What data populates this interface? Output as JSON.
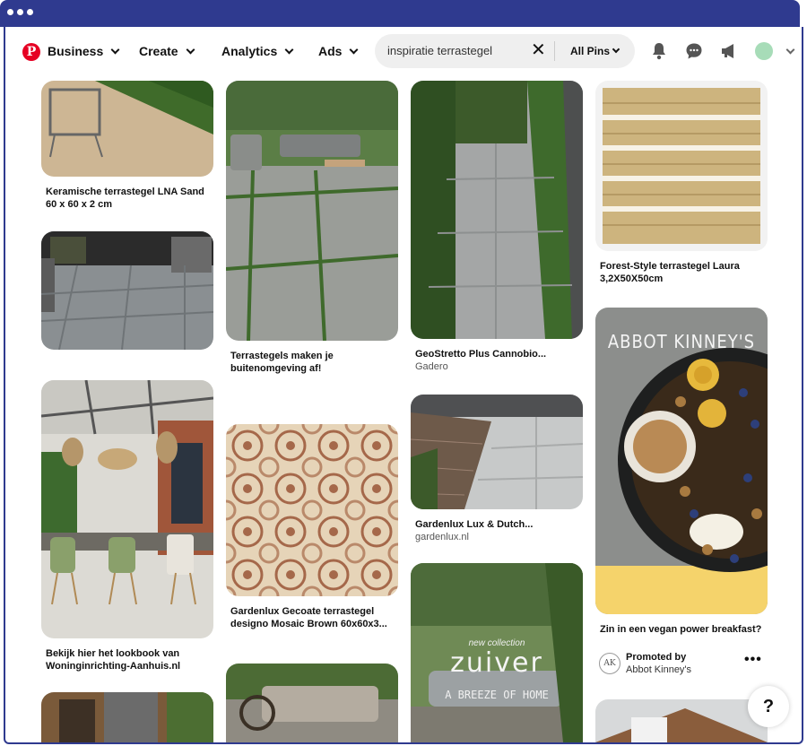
{
  "nav": {
    "business": "Business",
    "create": "Create",
    "analytics": "Analytics",
    "ads": "Ads"
  },
  "search": {
    "value": "inspiratie terrastegel",
    "filter": "All Pins"
  },
  "icons": {
    "logo": "pinterest-logo",
    "clear": "close-icon",
    "bell": "bell-icon",
    "messages": "chat-icon",
    "announce": "megaphone-icon"
  },
  "pins": {
    "p1": {
      "title": "Keramische terrastegel LNA Sand 60 x 60 x 2 cm"
    },
    "p2": {
      "title": "Terrastegels maken je buitenomgeving af!"
    },
    "p3": {
      "title": "GeoStretto Plus Cannobio...",
      "source": "Gadero"
    },
    "p4": {
      "title": "Forest-Style terrastegel Laura 3,2X50X50cm"
    },
    "p5": {
      "title": "Bekijk hier het lookbook van Woninginrichting-Aanhuis.nl"
    },
    "p6": {
      "title": "Gardenlux Gecoate terrastegel designo Mosaic Brown 60x60x3..."
    },
    "p7": {
      "title": "Gardenlux Lux & Dutch...",
      "source": "gardenlux.nl"
    },
    "p8": {
      "brand": "ABBOT KINNEY'S",
      "title": "Zin in een vegan power breakfast?",
      "promoted_label": "Promoted by",
      "promoter": "Abbot Kinney's",
      "avatar_text": "AK"
    },
    "p9": {
      "overlay_small": "new collection",
      "overlay_big": "zuiver",
      "overlay_tag": "A BREEZE OF HOME"
    }
  },
  "help": {
    "label": "?"
  }
}
